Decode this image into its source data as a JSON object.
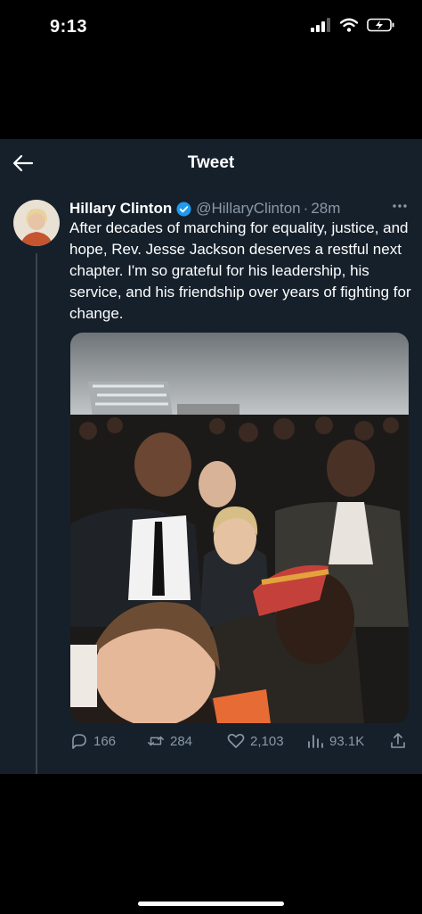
{
  "status_bar": {
    "time": "9:13",
    "battery_charging": true
  },
  "header": {
    "title": "Tweet",
    "back_icon": "arrow-left-icon"
  },
  "tweet": {
    "author_name": "Hillary Clinton",
    "verified": true,
    "handle": "@HillaryClinton",
    "separator": "·",
    "time_ago": "28m",
    "text": "After decades of marching for equality, justice, and hope, Rev. Jesse Jackson deserves a restful next chapter. I'm so grateful for his leadership, his service, and his friendship over years of fighting for change.",
    "media": {
      "type": "photo"
    }
  },
  "actions": {
    "replies": "166",
    "retweets": "284",
    "likes": "2,103",
    "views": "93.1K"
  },
  "colors": {
    "background": "#15202b",
    "accent": "#1d9bf0",
    "secondary_text": "#8b98a5",
    "divider": "#38444d"
  }
}
